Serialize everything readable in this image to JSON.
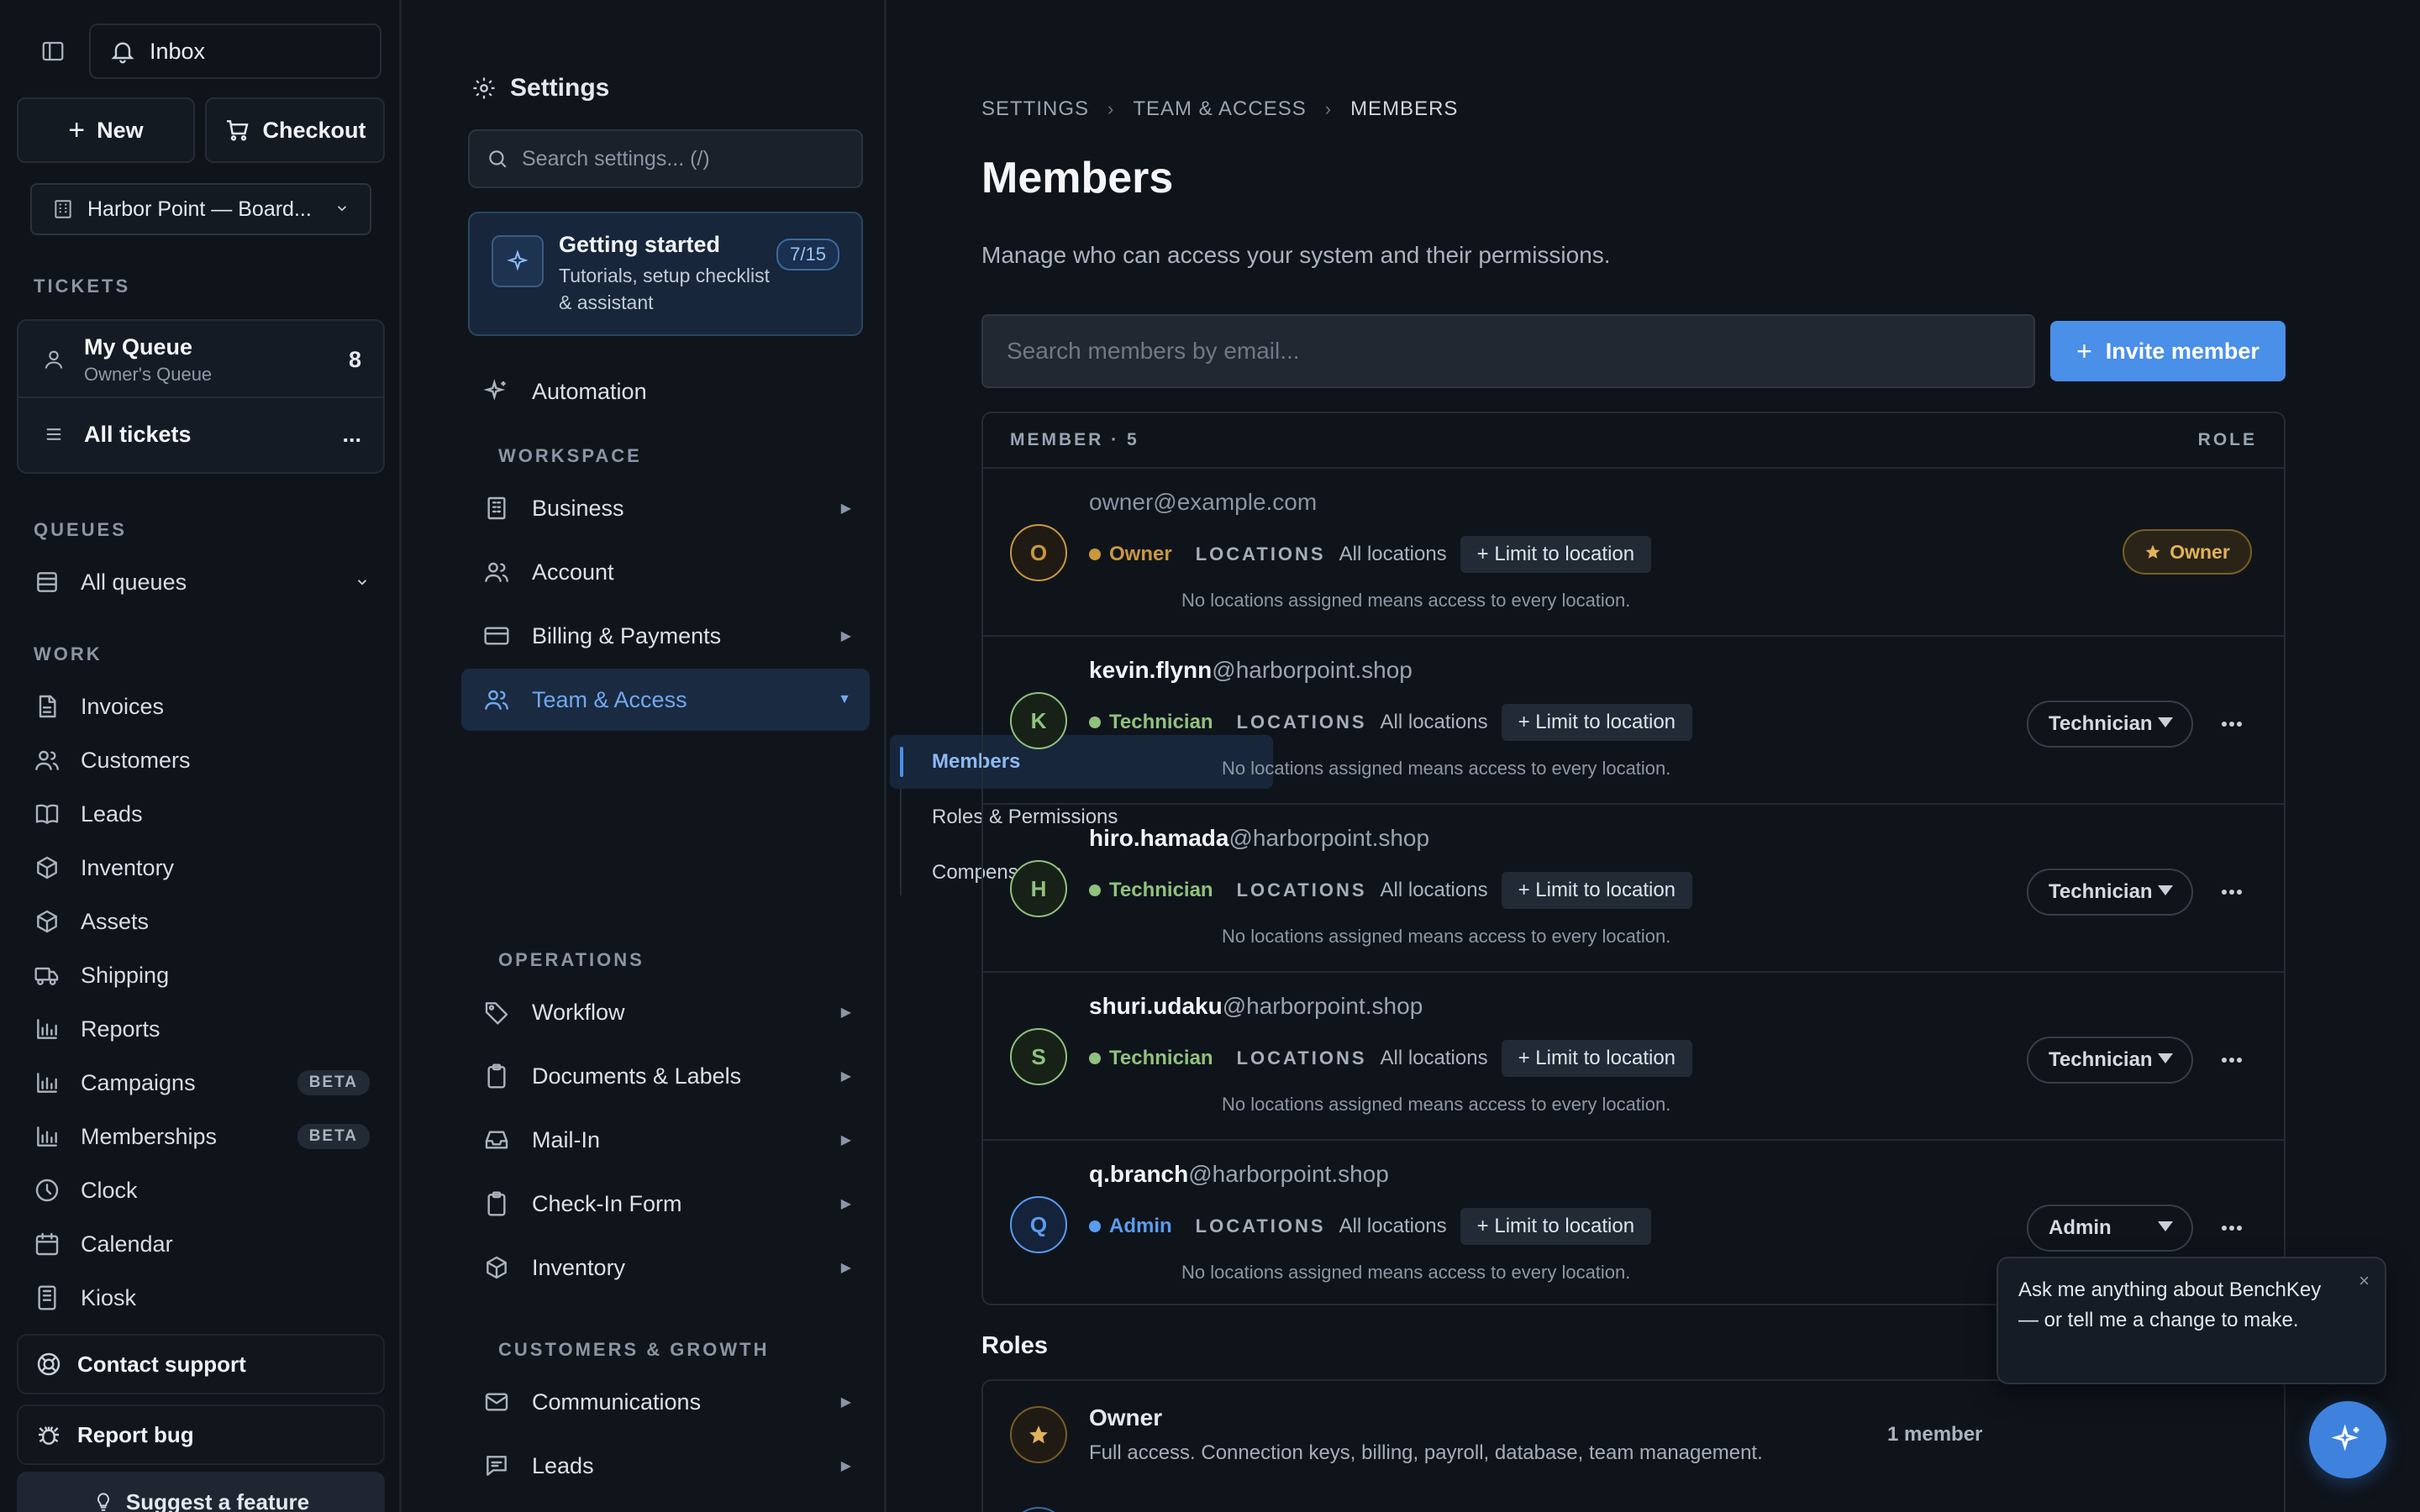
{
  "left_nav": {
    "inbox_label": "Inbox",
    "new_label": "New",
    "checkout_label": "Checkout",
    "location": "Harbor Point — Board...",
    "tickets_heading": "TICKETS",
    "my_queue": {
      "label": "My Queue",
      "sub": "Owner's Queue",
      "count": "8"
    },
    "all_tickets": {
      "label": "All tickets",
      "more": "..."
    },
    "queues_heading": "QUEUES",
    "all_queues": "All queues",
    "work_heading": "WORK",
    "work_items": [
      {
        "label": "Invoices",
        "icon": "document-icon"
      },
      {
        "label": "Customers",
        "icon": "users-icon"
      },
      {
        "label": "Leads",
        "icon": "book-icon"
      },
      {
        "label": "Inventory",
        "icon": "box-icon"
      },
      {
        "label": "Assets",
        "icon": "box-icon"
      },
      {
        "label": "Shipping",
        "icon": "truck-icon"
      },
      {
        "label": "Reports",
        "icon": "bar-chart-icon"
      },
      {
        "label": "Campaigns",
        "icon": "bar-chart-icon",
        "badge": "BETA"
      },
      {
        "label": "Memberships",
        "icon": "bar-chart-icon",
        "badge": "BETA"
      },
      {
        "label": "Clock",
        "icon": "clock-icon"
      },
      {
        "label": "Calendar",
        "icon": "calendar-icon"
      },
      {
        "label": "Kiosk",
        "icon": "tablet-icon"
      }
    ],
    "contact_support": "Contact support",
    "report_bug": "Report bug",
    "suggest_feature": "Suggest a feature"
  },
  "settings_nav": {
    "title": "Settings",
    "search_placeholder": "Search settings... (/)",
    "getting_started": {
      "title": "Getting started",
      "subtitle": "Tutorials, setup checklist & assistant",
      "progress": "7/15"
    },
    "automation": "Automation",
    "workspace_heading": "WORKSPACE",
    "workspace_items": [
      {
        "label": "Business",
        "icon": "building-icon"
      },
      {
        "label": "Account",
        "icon": "users-icon"
      },
      {
        "label": "Billing & Payments",
        "icon": "credit-card-icon"
      },
      {
        "label": "Team & Access",
        "icon": "users-icon"
      }
    ],
    "team_sub_items": [
      "Members",
      "Roles & Permissions",
      "Compensation"
    ],
    "operations_heading": "OPERATIONS",
    "operations_items": [
      {
        "label": "Workflow",
        "icon": "tag-icon"
      },
      {
        "label": "Documents & Labels",
        "icon": "clipboard-icon"
      },
      {
        "label": "Mail-In",
        "icon": "inbox-tray-icon"
      },
      {
        "label": "Check-In Form",
        "icon": "clipboard-icon"
      },
      {
        "label": "Inventory",
        "icon": "box-icon"
      }
    ],
    "growth_heading": "CUSTOMERS & GROWTH",
    "growth_items": [
      {
        "label": "Communications",
        "icon": "mail-icon"
      },
      {
        "label": "Leads",
        "icon": "chat-icon"
      }
    ]
  },
  "main": {
    "breadcrumb": [
      "SETTINGS",
      "TEAM & ACCESS",
      "MEMBERS"
    ],
    "title": "Members",
    "description": "Manage who can access your system and their permissions.",
    "search_placeholder": "Search members by email...",
    "invite_label": "Invite member",
    "table_head_member": "MEMBER · 5",
    "table_head_role": "ROLE",
    "locations_label": "LOCATIONS",
    "locations_value": "All locations",
    "limit_label": "+ Limit to location",
    "note": "No locations assigned means access to every location.",
    "members": [
      {
        "initial": "O",
        "user": "owner",
        "domain": "@example.com",
        "role": "Owner",
        "role_color": "#c9973f"
      },
      {
        "initial": "K",
        "user": "kevin.flynn",
        "domain": "@harborpoint.shop",
        "role": "Technician",
        "role_color": "#8fc27e",
        "select": "Technician"
      },
      {
        "initial": "H",
        "user": "hiro.hamada",
        "domain": "@harborpoint.shop",
        "role": "Technician",
        "role_color": "#8fc27e",
        "select": "Technician"
      },
      {
        "initial": "S",
        "user": "shuri.udaku",
        "domain": "@harborpoint.shop",
        "role": "Technician",
        "role_color": "#8fc27e",
        "select": "Technician"
      },
      {
        "initial": "Q",
        "user": "q.branch",
        "domain": "@harborpoint.shop",
        "role": "Admin",
        "role_color": "#5a9cf0",
        "select": "Admin"
      }
    ],
    "owner_pill": "Owner",
    "roles_title": "Roles",
    "role_owner": {
      "name": "Owner",
      "desc": "Full access. Connection keys, billing, payroll, database, team management.",
      "count": "1 member"
    }
  },
  "assistant": {
    "message": "Ask me anything about BenchKey — or tell me a change to make.",
    "close": "×"
  }
}
